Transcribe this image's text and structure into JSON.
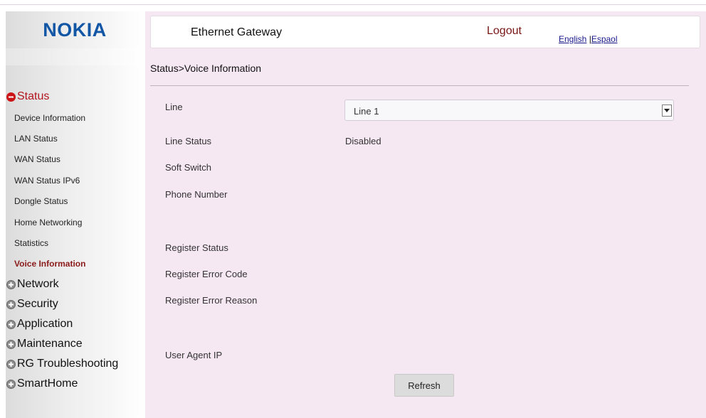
{
  "brand": {
    "logo_text": "NOKIA",
    "logo_color": "#1256a6"
  },
  "header": {
    "title": "Ethernet Gateway",
    "logout": "Logout",
    "lang_english": "English",
    "lang_separator": "|",
    "lang_spanish": "Espaol"
  },
  "breadcrumb": "Status>Voice Information",
  "sidebar": {
    "status": {
      "label": "Status",
      "expanded": true,
      "items": [
        "Device Information",
        "LAN Status",
        "WAN Status",
        "WAN Status IPv6",
        "Dongle Status",
        "Home Networking",
        "Statistics",
        "Voice Information"
      ],
      "active_item": "Voice Information"
    },
    "collapsed_sections": [
      "Network",
      "Security",
      "Application",
      "Maintenance",
      "RG Troubleshooting",
      "SmartHome"
    ]
  },
  "form": {
    "line_label": "Line",
    "line_selected": "Line 1",
    "line_status_label": "Line Status",
    "line_status_value": "Disabled",
    "soft_switch_label": "Soft Switch",
    "phone_number_label": "Phone Number",
    "register_status_label": "Register Status",
    "register_error_code_label": "Register Error Code",
    "register_error_reason_label": "Register Error Reason",
    "user_agent_ip_label": "User Agent IP"
  },
  "buttons": {
    "refresh": "Refresh"
  },
  "colors": {
    "panel_background": "#f5e8f3",
    "active_section": "#b3141d",
    "active_item": "#8b1b1b",
    "logout": "#7a1616"
  }
}
